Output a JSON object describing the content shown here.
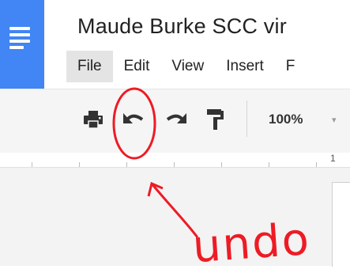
{
  "app": {
    "document_title": "Maude Burke SCC vir",
    "accent_color": "#4285f4"
  },
  "menu": {
    "items": [
      {
        "label": "File"
      },
      {
        "label": "Edit"
      },
      {
        "label": "View"
      },
      {
        "label": "Insert"
      },
      {
        "label": "F"
      }
    ]
  },
  "toolbar": {
    "icons": [
      "print-icon",
      "undo-icon",
      "redo-icon",
      "paint-format-icon"
    ],
    "zoom_label": "100%",
    "zoom_caret": "▾"
  },
  "ruler": {
    "number": "1"
  },
  "annotation": {
    "text": "undo",
    "color": "#ee1b24"
  }
}
